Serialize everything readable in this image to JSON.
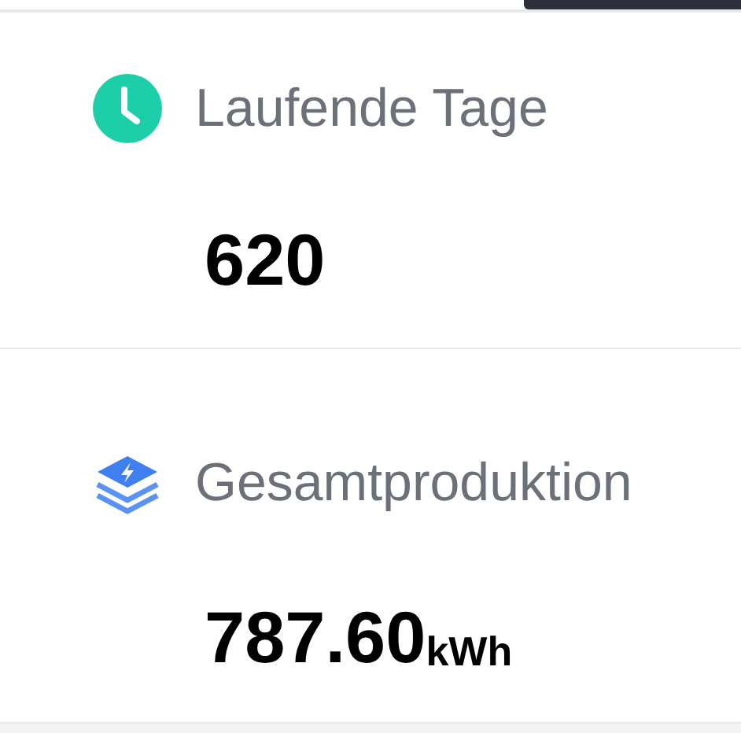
{
  "stats": [
    {
      "label": "Laufende Tage",
      "value": "620"
    },
    {
      "label": "Gesamtproduktion",
      "value": "787.60",
      "unit": "kWh"
    }
  ]
}
